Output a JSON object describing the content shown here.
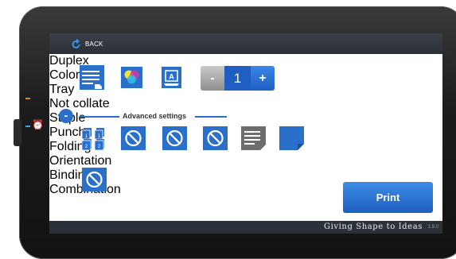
{
  "topbar": {
    "back_label": "BACK"
  },
  "basic_options": [
    {
      "label": "Duplex",
      "icon": "duplex-icon"
    },
    {
      "label": "Color",
      "icon": "color-icon"
    },
    {
      "label": "Tray",
      "icon": "tray-icon"
    }
  ],
  "copies": {
    "minus": "-",
    "value": "1",
    "plus": "+"
  },
  "advanced": {
    "toggle": "-",
    "title": "Advanced settings"
  },
  "advanced_options": [
    {
      "label": "Not collate",
      "icon": "not-collate-icon"
    },
    {
      "label": "Staple",
      "icon": "no-symbol-icon"
    },
    {
      "label": "Punch",
      "icon": "no-symbol-icon"
    },
    {
      "label": "Folding",
      "icon": "no-symbol-icon"
    },
    {
      "label": "Orientation",
      "icon": "orientation-icon"
    },
    {
      "label": "Binding",
      "icon": "binding-icon"
    },
    {
      "label": "Combination",
      "icon": "no-symbol-icon"
    }
  ],
  "print_button": {
    "label": "Print"
  },
  "footer": {
    "brand": "Giving Shape to Ideas",
    "version": "1.9.0"
  },
  "colors": {
    "accent": "#2a6fc9",
    "bar": "#2c3139"
  }
}
